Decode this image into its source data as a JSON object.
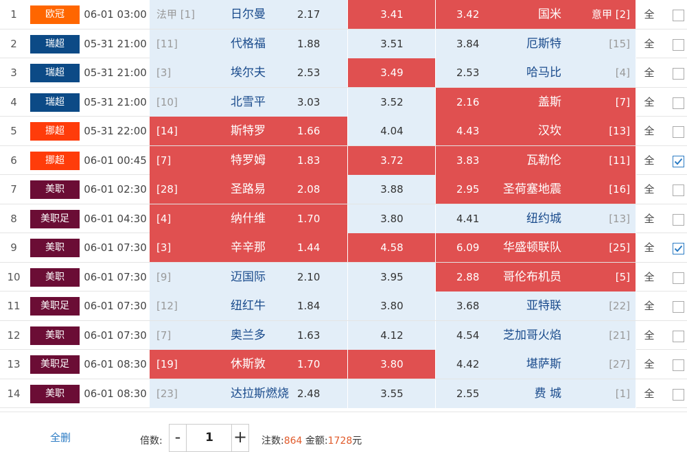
{
  "colors": {
    "highlight": "#e05050",
    "odds_bg": "#e3eef8",
    "league_orange": "#ff6600",
    "league_blue": "#0c4a86",
    "league_red": "#ff3c0a",
    "league_maroon": "#6b0d35"
  },
  "matches": [
    {
      "idx": "1",
      "league": "欧冠",
      "lcolor": "#ff6600",
      "time": "06-01 03:00",
      "home_rank": "法甲 [1]",
      "home": "日尔曼",
      "home_odds": "2.17",
      "draw_odds": "3.41",
      "away_odds": "3.42",
      "away": "国米",
      "away_rank": "意甲 [2]",
      "all": "全",
      "sel": [
        false,
        true,
        true
      ],
      "checked": false
    },
    {
      "idx": "2",
      "league": "瑞超",
      "lcolor": "#0c4a86",
      "time": "05-31 21:00",
      "home_rank": "[11]",
      "home": "代格福",
      "home_odds": "1.88",
      "draw_odds": "3.51",
      "away_odds": "3.84",
      "away": "厄斯特",
      "away_rank": "[15]",
      "all": "全",
      "sel": [
        false,
        false,
        false
      ],
      "checked": false
    },
    {
      "idx": "3",
      "league": "瑞超",
      "lcolor": "#0c4a86",
      "time": "05-31 21:00",
      "home_rank": "[3]",
      "home": "埃尔夫",
      "home_odds": "2.53",
      "draw_odds": "3.49",
      "away_odds": "2.53",
      "away": "哈马比",
      "away_rank": "[4]",
      "all": "全",
      "sel": [
        false,
        true,
        false
      ],
      "checked": false
    },
    {
      "idx": "4",
      "league": "瑞超",
      "lcolor": "#0c4a86",
      "time": "05-31 21:00",
      "home_rank": "[10]",
      "home": "北雪平",
      "home_odds": "3.03",
      "draw_odds": "3.52",
      "away_odds": "2.16",
      "away": "盖斯",
      "away_rank": "[7]",
      "all": "全",
      "sel": [
        false,
        false,
        true
      ],
      "checked": false
    },
    {
      "idx": "5",
      "league": "挪超",
      "lcolor": "#ff3c0a",
      "time": "05-31 22:00",
      "home_rank": "[14]",
      "home": "斯特罗",
      "home_odds": "1.66",
      "draw_odds": "4.04",
      "away_odds": "4.43",
      "away": "汉坎",
      "away_rank": "[13]",
      "all": "全",
      "sel": [
        true,
        false,
        true
      ],
      "checked": false
    },
    {
      "idx": "6",
      "league": "挪超",
      "lcolor": "#ff3c0a",
      "time": "06-01 00:45",
      "home_rank": "[7]",
      "home": "特罗姆",
      "home_odds": "1.83",
      "draw_odds": "3.72",
      "away_odds": "3.83",
      "away": "瓦勒伦",
      "away_rank": "[11]",
      "all": "全",
      "sel": [
        true,
        true,
        true
      ],
      "checked": true
    },
    {
      "idx": "7",
      "league": "美职",
      "lcolor": "#6b0d35",
      "time": "06-01 02:30",
      "home_rank": "[28]",
      "home": "圣路易",
      "home_odds": "2.08",
      "draw_odds": "3.88",
      "away_odds": "2.95",
      "away": "圣荷塞地震",
      "away_rank": "[16]",
      "all": "全",
      "sel": [
        true,
        false,
        true
      ],
      "checked": false
    },
    {
      "idx": "8",
      "league": "美职足",
      "lcolor": "#6b0d35",
      "time": "06-01 04:30",
      "home_rank": "[4]",
      "home": "纳什维",
      "home_odds": "1.70",
      "draw_odds": "3.80",
      "away_odds": "4.41",
      "away": "纽约城",
      "away_rank": "[13]",
      "all": "全",
      "sel": [
        true,
        false,
        false
      ],
      "checked": false
    },
    {
      "idx": "9",
      "league": "美职",
      "lcolor": "#6b0d35",
      "time": "06-01 07:30",
      "home_rank": "[3]",
      "home": "辛辛那",
      "home_odds": "1.44",
      "draw_odds": "4.58",
      "away_odds": "6.09",
      "away": "华盛顿联队",
      "away_rank": "[25]",
      "all": "全",
      "sel": [
        true,
        true,
        true
      ],
      "checked": true
    },
    {
      "idx": "10",
      "league": "美职",
      "lcolor": "#6b0d35",
      "time": "06-01 07:30",
      "home_rank": "[9]",
      "home": "迈国际",
      "home_odds": "2.10",
      "draw_odds": "3.95",
      "away_odds": "2.88",
      "away": "哥伦布机员",
      "away_rank": "[5]",
      "all": "全",
      "sel": [
        false,
        false,
        true
      ],
      "checked": false
    },
    {
      "idx": "11",
      "league": "美职足",
      "lcolor": "#6b0d35",
      "time": "06-01 07:30",
      "home_rank": "[12]",
      "home": "纽红牛",
      "home_odds": "1.84",
      "draw_odds": "3.80",
      "away_odds": "3.68",
      "away": "亚特联",
      "away_rank": "[22]",
      "all": "全",
      "sel": [
        false,
        false,
        false
      ],
      "checked": false
    },
    {
      "idx": "12",
      "league": "美职",
      "lcolor": "#6b0d35",
      "time": "06-01 07:30",
      "home_rank": "[7]",
      "home": "奥兰多",
      "home_odds": "1.63",
      "draw_odds": "4.12",
      "away_odds": "4.54",
      "away": "芝加哥火焰",
      "away_rank": "[21]",
      "all": "全",
      "sel": [
        false,
        false,
        false
      ],
      "checked": false
    },
    {
      "idx": "13",
      "league": "美职足",
      "lcolor": "#6b0d35",
      "time": "06-01 08:30",
      "home_rank": "[19]",
      "home": "休斯敦",
      "home_odds": "1.70",
      "draw_odds": "3.80",
      "away_odds": "4.42",
      "away": "堪萨斯",
      "away_rank": "[27]",
      "all": "全",
      "sel": [
        true,
        true,
        false
      ],
      "checked": false
    },
    {
      "idx": "14",
      "league": "美职",
      "lcolor": "#6b0d35",
      "time": "06-01 08:30",
      "home_rank": "[23]",
      "home": "达拉斯燃烧",
      "home_odds": "2.48",
      "draw_odds": "3.55",
      "away_odds": "2.55",
      "away": "费 城",
      "away_rank": "[1]",
      "all": "全",
      "sel": [
        false,
        false,
        false
      ],
      "checked": false
    }
  ],
  "footer": {
    "delete_all": "全删",
    "multiplier_label": "倍数:",
    "minus": "-",
    "multiplier": "1",
    "plus": "+",
    "bets_label": "注数:",
    "bets": "864",
    "amount_label": "金额:",
    "amount": "1728",
    "currency": "元"
  }
}
